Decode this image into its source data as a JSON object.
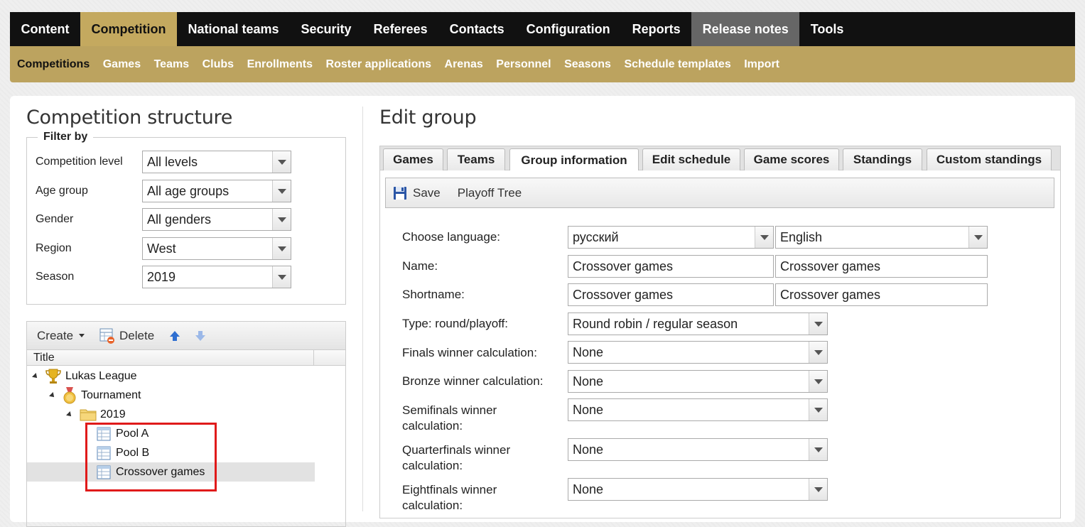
{
  "topnav": {
    "items": [
      "Content",
      "Competition",
      "National teams",
      "Security",
      "Referees",
      "Contacts",
      "Configuration",
      "Reports",
      "Release notes",
      "Tools"
    ],
    "active": "Competition"
  },
  "subnav": {
    "items": [
      "Competitions",
      "Games",
      "Teams",
      "Clubs",
      "Enrollments",
      "Roster applications",
      "Arenas",
      "Personnel",
      "Seasons",
      "Schedule templates",
      "Import"
    ],
    "active": "Competitions"
  },
  "left": {
    "title": "Competition structure",
    "filter": {
      "legend": "Filter by",
      "competition_level": {
        "label": "Competition level",
        "value": "All levels"
      },
      "age_group": {
        "label": "Age group",
        "value": "All age groups"
      },
      "gender": {
        "label": "Gender",
        "value": "All genders"
      },
      "region": {
        "label": "Region",
        "value": "West"
      },
      "season": {
        "label": "Season",
        "value": "2019"
      }
    },
    "tree": {
      "create_label": "Create",
      "delete_label": "Delete",
      "column_title": "Title",
      "nodes": {
        "league": "Lukas League",
        "tournament": "Tournament",
        "season": "2019",
        "pool_a": "Pool A",
        "pool_b": "Pool B",
        "crossover": "Crossover games"
      }
    }
  },
  "right": {
    "title": "Edit group",
    "tabs": [
      "Games",
      "Teams",
      "Group information",
      "Edit schedule",
      "Game scores",
      "Standings",
      "Custom standings"
    ],
    "active_tab": "Group information",
    "toolbar": {
      "save_label": "Save",
      "playoff_label": "Playoff Tree"
    },
    "form": {
      "language": {
        "label": "Choose language:",
        "value1": "русский",
        "value2": "English"
      },
      "name": {
        "label": "Name:",
        "value1": "Crossover games",
        "value2": "Crossover games"
      },
      "shortname": {
        "label": "Shortname:",
        "value1": "Crossover games",
        "value2": "Crossover games"
      },
      "type": {
        "label": "Type: round/playoff:",
        "value": "Round robin / regular season"
      },
      "finals": {
        "label": "Finals winner calculation:",
        "value": "None"
      },
      "bronze": {
        "label": "Bronze winner calculation:",
        "value": "None"
      },
      "semifinals": {
        "label_line1": "Semifinals winner",
        "label_line2": "calculation:",
        "value": "None"
      },
      "quarterfinals": {
        "label_line1": "Quarterfinals winner",
        "label_line2": "calculation:",
        "value": "None"
      },
      "eightfinals": {
        "label_line1": "Eightfinals winner",
        "label_line2": "calculation:",
        "value": "None"
      }
    }
  }
}
